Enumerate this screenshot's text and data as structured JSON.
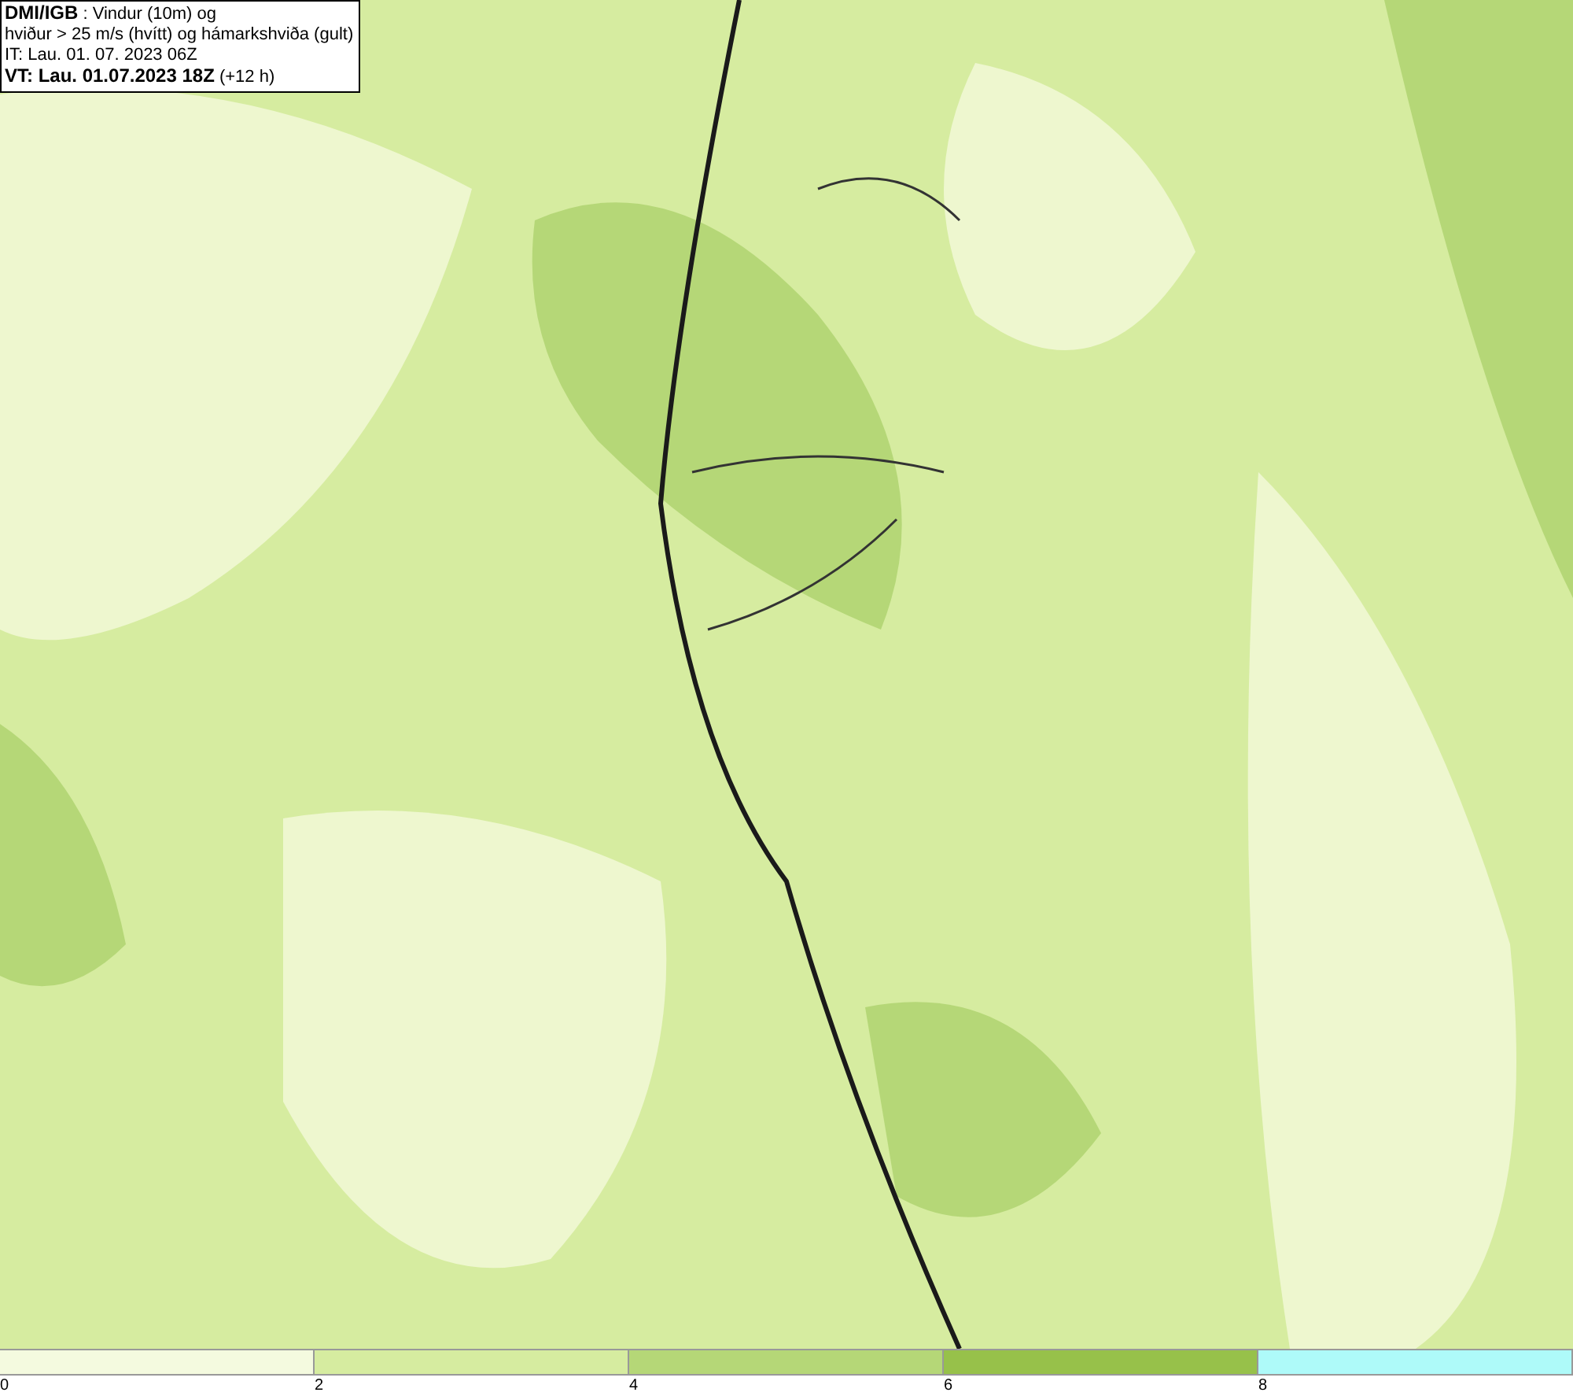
{
  "header": {
    "lines": [
      "**DMI/IGB** : Vindur (10m) og",
      "hviður > 25 m/s (hvítt) og hámarkshviða (gult)",
      "IT: Lau. 01. 07. 2023 06Z",
      "**VT: Lau. 01.07.2023 18Z** (+12 h)"
    ]
  },
  "legend": {
    "bins": [
      {
        "color": "#f4fadf",
        "label": "0"
      },
      {
        "color": "#d6eca0",
        "label": "2"
      },
      {
        "color": "#b5d777",
        "label": "4"
      },
      {
        "color": "#97c14a",
        "label": "6"
      },
      {
        "color": "#aefaf9",
        "label": "8"
      }
    ]
  }
}
